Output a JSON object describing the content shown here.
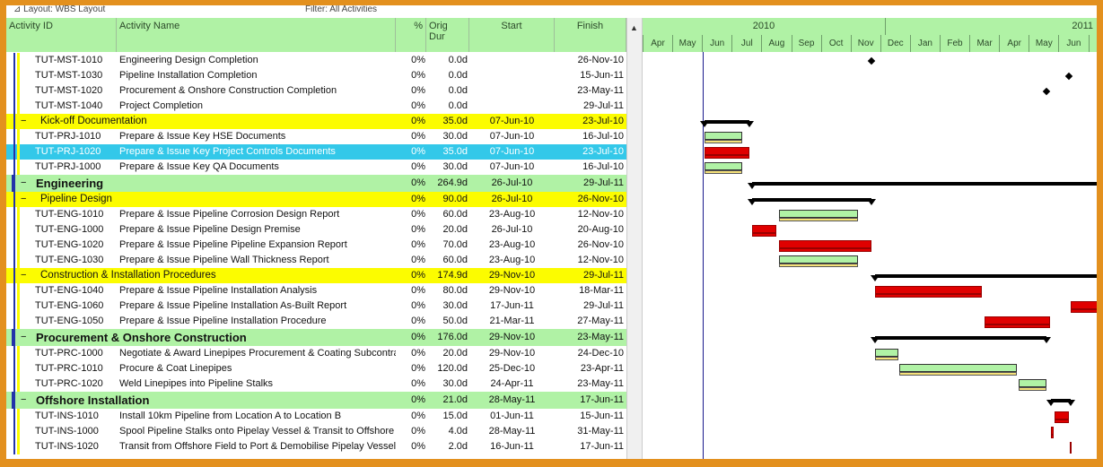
{
  "topbar": {
    "layout": "⊿ Layout: WBS Layout",
    "filter": "Filter: All Activities"
  },
  "columns": {
    "id": "Activity ID",
    "name": "Activity Name",
    "pct": "%",
    "dur": "Orig Dur",
    "start": "Start",
    "finish": "Finish"
  },
  "gantt": {
    "years": [
      "2010",
      "2011"
    ],
    "months": [
      "Apr",
      "May",
      "Jun",
      "Jul",
      "Aug",
      "Sep",
      "Oct",
      "Nov",
      "Dec",
      "Jan",
      "Feb",
      "Mar",
      "Apr",
      "May",
      "Jun",
      "Jul"
    ]
  },
  "rows": [
    {
      "id": "TUT-MST-1010",
      "name": "Engineering Design Completion",
      "pct": "0%",
      "dur": "0.0d",
      "start": "",
      "finish": "26-Nov-10",
      "type": "task"
    },
    {
      "id": "TUT-MST-1030",
      "name": "Pipeline Installation Completion",
      "pct": "0%",
      "dur": "0.0d",
      "start": "",
      "finish": "15-Jun-11",
      "type": "task"
    },
    {
      "id": "TUT-MST-1020",
      "name": "Procurement & Onshore Construction Completion",
      "pct": "0%",
      "dur": "0.0d",
      "start": "",
      "finish": "23-May-11",
      "type": "task"
    },
    {
      "id": "TUT-MST-1040",
      "name": "Project Completion",
      "pct": "0%",
      "dur": "0.0d",
      "start": "",
      "finish": "29-Jul-11",
      "type": "task"
    },
    {
      "id": "Kick-off Documentation",
      "name": "",
      "pct": "0%",
      "dur": "35.0d",
      "start": "07-Jun-10",
      "finish": "23-Jul-10",
      "type": "group2",
      "toggle": "−"
    },
    {
      "id": "TUT-PRJ-1010",
      "name": "Prepare & Issue Key HSE Documents",
      "pct": "0%",
      "dur": "30.0d",
      "start": "07-Jun-10",
      "finish": "16-Jul-10",
      "type": "task"
    },
    {
      "id": "TUT-PRJ-1020",
      "name": "Prepare & Issue Key Project Controls Documents",
      "pct": "0%",
      "dur": "35.0d",
      "start": "07-Jun-10",
      "finish": "23-Jul-10",
      "type": "sel"
    },
    {
      "id": "TUT-PRJ-1000",
      "name": "Prepare & Issue Key QA Documents",
      "pct": "0%",
      "dur": "30.0d",
      "start": "07-Jun-10",
      "finish": "16-Jul-10",
      "type": "task"
    },
    {
      "id": "Engineering",
      "name": "",
      "pct": "0%",
      "dur": "264.9d",
      "start": "26-Jul-10",
      "finish": "29-Jul-11",
      "type": "group1",
      "toggle": "−"
    },
    {
      "id": "Pipeline Design",
      "name": "",
      "pct": "0%",
      "dur": "90.0d",
      "start": "26-Jul-10",
      "finish": "26-Nov-10",
      "type": "group2",
      "toggle": "−"
    },
    {
      "id": "TUT-ENG-1010",
      "name": "Prepare & Issue Pipeline Corrosion Design Report",
      "pct": "0%",
      "dur": "60.0d",
      "start": "23-Aug-10",
      "finish": "12-Nov-10",
      "type": "task"
    },
    {
      "id": "TUT-ENG-1000",
      "name": "Prepare & Issue Pipeline Design Premise",
      "pct": "0%",
      "dur": "20.0d",
      "start": "26-Jul-10",
      "finish": "20-Aug-10",
      "type": "task"
    },
    {
      "id": "TUT-ENG-1020",
      "name": "Prepare & Issue Pipeline Pipeline Expansion Report",
      "pct": "0%",
      "dur": "70.0d",
      "start": "23-Aug-10",
      "finish": "26-Nov-10",
      "type": "task"
    },
    {
      "id": "TUT-ENG-1030",
      "name": "Prepare & Issue Pipeline Wall Thickness Report",
      "pct": "0%",
      "dur": "60.0d",
      "start": "23-Aug-10",
      "finish": "12-Nov-10",
      "type": "task"
    },
    {
      "id": "Construction & Installation Procedures",
      "name": "",
      "pct": "0%",
      "dur": "174.9d",
      "start": "29-Nov-10",
      "finish": "29-Jul-11",
      "type": "group2",
      "toggle": "−"
    },
    {
      "id": "TUT-ENG-1040",
      "name": "Prepare & Issue Pipeline Installation Analysis",
      "pct": "0%",
      "dur": "80.0d",
      "start": "29-Nov-10",
      "finish": "18-Mar-11",
      "type": "task"
    },
    {
      "id": "TUT-ENG-1060",
      "name": "Prepare & Issue Pipeline Installation As-Built Report",
      "pct": "0%",
      "dur": "30.0d",
      "start": "17-Jun-11",
      "finish": "29-Jul-11",
      "type": "task"
    },
    {
      "id": "TUT-ENG-1050",
      "name": "Prepare & Issue Pipeline Installation Procedure",
      "pct": "0%",
      "dur": "50.0d",
      "start": "21-Mar-11",
      "finish": "27-May-11",
      "type": "task"
    },
    {
      "id": "Procurement & Onshore Construction",
      "name": "",
      "pct": "0%",
      "dur": "176.0d",
      "start": "29-Nov-10",
      "finish": "23-May-11",
      "type": "group1",
      "toggle": "−"
    },
    {
      "id": "TUT-PRC-1000",
      "name": "Negotiate & Award Linepipes Procurement & Coating Subcontract",
      "pct": "0%",
      "dur": "20.0d",
      "start": "29-Nov-10",
      "finish": "24-Dec-10",
      "type": "task"
    },
    {
      "id": "TUT-PRC-1010",
      "name": "Procure & Coat Linepipes",
      "pct": "0%",
      "dur": "120.0d",
      "start": "25-Dec-10",
      "finish": "23-Apr-11",
      "type": "task"
    },
    {
      "id": "TUT-PRC-1020",
      "name": "Weld Linepipes into Pipeline Stalks",
      "pct": "0%",
      "dur": "30.0d",
      "start": "24-Apr-11",
      "finish": "23-May-11",
      "type": "task"
    },
    {
      "id": "Offshore Installation",
      "name": "",
      "pct": "0%",
      "dur": "21.0d",
      "start": "28-May-11",
      "finish": "17-Jun-11",
      "type": "group1",
      "toggle": "−"
    },
    {
      "id": "TUT-INS-1010",
      "name": "Install 10km Pipeline from Location A to Location B",
      "pct": "0%",
      "dur": "15.0d",
      "start": "01-Jun-11",
      "finish": "15-Jun-11",
      "type": "task"
    },
    {
      "id": "TUT-INS-1000",
      "name": "Spool Pipeline Stalks onto Pipelay Vessel & Transit to Offshore Field",
      "pct": "0%",
      "dur": "4.0d",
      "start": "28-May-11",
      "finish": "31-May-11",
      "type": "task"
    },
    {
      "id": "TUT-INS-1020",
      "name": "Transit from Offshore Field to Port & Demobilise Pipelay Vessel",
      "pct": "0%",
      "dur": "2.0d",
      "start": "16-Jun-11",
      "finish": "17-Jun-11",
      "type": "task"
    }
  ],
  "colors": {
    "header": "#b0f2a5",
    "group_yellow": "#fcfc00",
    "group_green": "#b0f2a5",
    "selected": "#33c8e9",
    "bar_green": "#b0f2a5",
    "bar_red": "#e00000",
    "frame": "#e3901e"
  }
}
